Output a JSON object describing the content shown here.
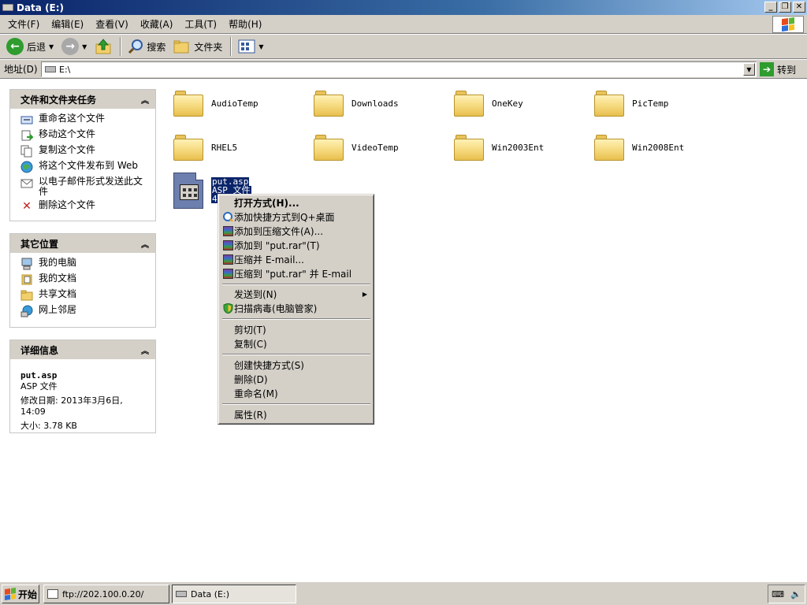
{
  "window": {
    "title": "Data (E:)"
  },
  "menubar": {
    "items": [
      "文件(F)",
      "编辑(E)",
      "查看(V)",
      "收藏(A)",
      "工具(T)",
      "帮助(H)"
    ]
  },
  "toolbar": {
    "back": "后退",
    "search": "搜索",
    "folders": "文件夹"
  },
  "address": {
    "label": "地址(D)",
    "value": "E:\\",
    "go": "转到"
  },
  "tasks_panel": {
    "title": "文件和文件夹任务",
    "items": [
      "重命名这个文件",
      "移动这个文件",
      "复制这个文件",
      "将这个文件发布到 Web",
      "以电子邮件形式发送此文件",
      "删除这个文件"
    ]
  },
  "places_panel": {
    "title": "其它位置",
    "items": [
      "我的电脑",
      "我的文档",
      "共享文档",
      "网上邻居"
    ]
  },
  "details_panel": {
    "title": "详细信息",
    "name": "put.asp",
    "type": "ASP 文件",
    "modified": "修改日期: 2013年3月6日, 14:09",
    "size": "大小: 3.78 KB"
  },
  "folders": [
    "AudioTemp",
    "Downloads",
    "OneKey",
    "PicTemp",
    "RHEL5",
    "VideoTemp",
    "Win2003Ent",
    "Win2008Ent"
  ],
  "selected_file": {
    "name": "put.asp",
    "type": "ASP 文件",
    "size": "4"
  },
  "context_menu": {
    "open_with": "打开方式(H)...",
    "add_shortcut": "添加快捷方式到Q+桌面",
    "add_archive": "添加到压缩文件(A)...",
    "add_to_rar": "添加到 \"put.rar\"(T)",
    "compress_email": "压缩并 E-mail...",
    "compress_rar_email": "压缩到 \"put.rar\" 并 E-mail",
    "send_to": "发送到(N)",
    "scan_virus": "扫描病毒(电脑管家)",
    "cut": "剪切(T)",
    "copy": "复制(C)",
    "create_shortcut": "创建快捷方式(S)",
    "delete": "删除(D)",
    "rename": "重命名(M)",
    "properties": "属性(R)"
  },
  "taskbar": {
    "start": "开始",
    "tasks": [
      "ftp://202.100.0.20/",
      "Data (E:)"
    ]
  },
  "colors": {
    "title_start": "#0a246a",
    "selection": "#0a246a",
    "chrome": "#d4d0c8"
  }
}
